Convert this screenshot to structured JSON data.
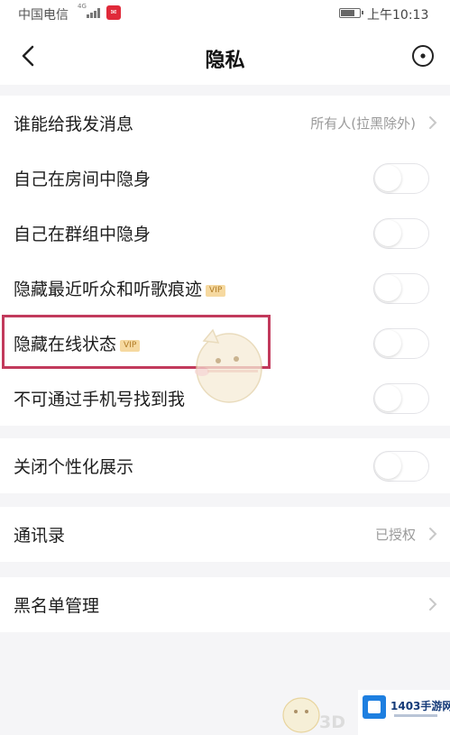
{
  "status_bar": {
    "carrier": "中国电信",
    "network_type": "4G",
    "time": "上午10:13",
    "battery_level": 0.8
  },
  "header": {
    "title": "隐私",
    "back_icon": "chevron-left-icon",
    "more_icon": "circle-dot-icon"
  },
  "sections": {
    "messaging": {
      "who_can_message": {
        "label": "谁能给我发消息",
        "value": "所有人(拉黑除外)"
      },
      "invisible_in_room": {
        "label": "自己在房间中隐身",
        "enabled": false
      },
      "invisible_in_group": {
        "label": "自己在群组中隐身",
        "enabled": false
      },
      "hide_recent_listeners": {
        "label": "隐藏最近听众和听歌痕迹",
        "vip": "VIP",
        "enabled": false
      },
      "hide_online_status": {
        "label": "隐藏在线状态",
        "vip": "VIP",
        "enabled": false
      },
      "no_find_by_phone": {
        "label": "不可通过手机号找到我",
        "enabled": false
      }
    },
    "personalization": {
      "close_personalized": {
        "label": "关闭个性化展示",
        "enabled": false
      }
    },
    "contacts": {
      "address_book": {
        "label": "通讯录",
        "value": "已授权"
      }
    },
    "blacklist": {
      "manage": {
        "label": "黑名单管理"
      }
    }
  },
  "colors": {
    "highlight_border": "#c23a5c",
    "vip_badge_bg": "#f6d9a0",
    "vip_badge_text": "#b07a24",
    "page_bg": "#f5f5f7"
  },
  "watermark": {
    "text_3d": "3D",
    "brand": "1403手游网"
  }
}
